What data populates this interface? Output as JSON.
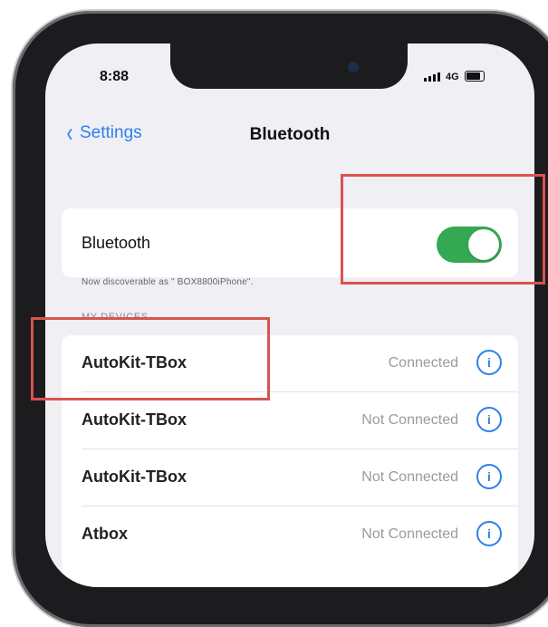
{
  "status_bar": {
    "time": "8:88",
    "network": "4G"
  },
  "nav": {
    "back_label": "Settings",
    "title": "Bluetooth"
  },
  "bluetooth": {
    "label": "Bluetooth",
    "enabled": true,
    "discoverable_text": "Now discoverable as \" BOX8800iPhone\"."
  },
  "section": {
    "header": "MY DEVICES"
  },
  "devices": [
    {
      "name": "AutoKit-TBox",
      "status": "Connected"
    },
    {
      "name": "AutoKit-TBox",
      "status": "Not Connected"
    },
    {
      "name": "AutoKit-TBox",
      "status": "Not Connected"
    },
    {
      "name": "Atbox",
      "status": "Not Connected"
    }
  ],
  "colors": {
    "accent": "#2f80ed",
    "toggle_on": "#34a853",
    "annotation": "#d9534f"
  }
}
